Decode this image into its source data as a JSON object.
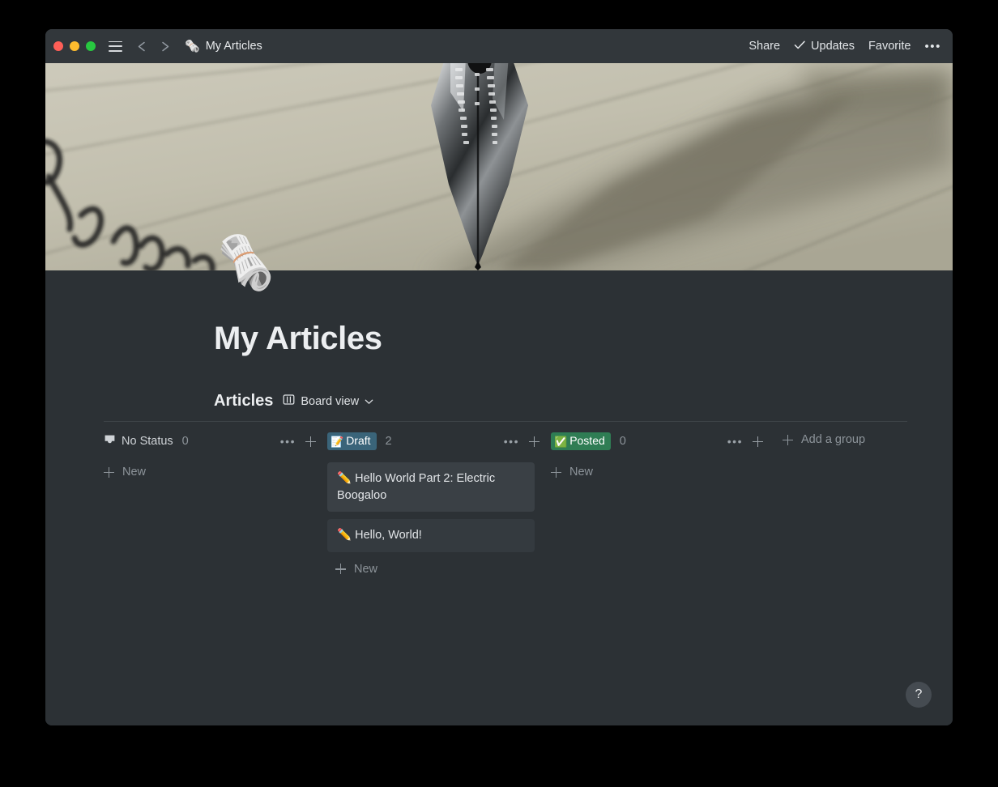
{
  "window": {
    "traffic_lights": [
      "close",
      "minimize",
      "maximize"
    ],
    "sidebar_toggle_icon": "hamburger-icon",
    "back_icon": "arrow-left-icon",
    "forward_icon": "arrow-right-icon",
    "title_icon": "rolled-newspaper-emoji",
    "title": "My Articles"
  },
  "titlebar_actions": {
    "share_label": "Share",
    "updates_label": "Updates",
    "updates_icon": "check-icon",
    "favorite_label": "Favorite",
    "more_label": "•••"
  },
  "page": {
    "icon": "🗞️",
    "title": "My Articles",
    "cover_alt": "fountain-pen-nib-on-lined-paper"
  },
  "database": {
    "name": "Articles",
    "view_icon": "board-view-icon",
    "view_label": "Board view",
    "view_chevron": "chevron-down-icon"
  },
  "board": {
    "add_group_label": "Add a group",
    "new_label": "New",
    "more_label": "•••",
    "columns": [
      {
        "id": "no-status",
        "label": "No Status",
        "icon": "inbox-icon",
        "chip": false,
        "count": "0",
        "cards": []
      },
      {
        "id": "draft",
        "label": "Draft",
        "chip": true,
        "chip_emoji": "📝",
        "chip_color": "#3a6479",
        "count": "2",
        "cards": [
          {
            "emoji": "✏️",
            "title": "Hello World Part 2: Electric Boogaloo",
            "hovered": true
          },
          {
            "emoji": "✏️",
            "title": "Hello, World!",
            "hovered": false
          }
        ]
      },
      {
        "id": "posted",
        "label": "Posted",
        "chip": true,
        "chip_emoji": "✅",
        "chip_color": "#2f7d54",
        "count": "0",
        "cards": []
      }
    ]
  },
  "help": {
    "label": "?"
  },
  "colors": {
    "window_bg": "#2c3135",
    "titlebar_bg": "#32373b",
    "card_bg": "#343a3f",
    "card_hover_bg": "#3a4045",
    "text_primary": "#eceef0",
    "text_muted": "#8d949a",
    "draft_chip": "#3a6479",
    "posted_chip": "#2f7d54"
  }
}
